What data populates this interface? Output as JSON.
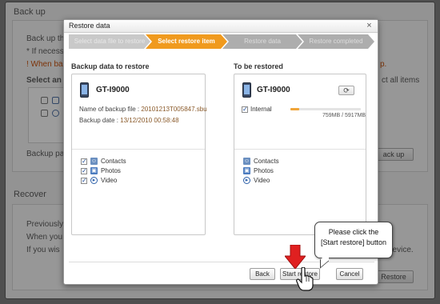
{
  "background": {
    "backup_section": "Back up",
    "backup_line1": "Back up th",
    "backup_line2": "* If necess",
    "backup_warning": "! When ba",
    "backup_warning_tail": "p.",
    "select_label": "Select an",
    "select_all": "ct all items",
    "backup_path_label": "Backup pa",
    "backup_btn": "ack up",
    "recover_section": "Recover",
    "recover_line1": "Previously",
    "recover_line2": "When you",
    "recover_line3": "If you wis",
    "recover_tail": "device.",
    "restore_btn": "Restore"
  },
  "dialog": {
    "title": "Restore data",
    "close": "×",
    "steps": [
      {
        "label": "Select data file to restore",
        "state": "done"
      },
      {
        "label": "Select restore item",
        "state": "active"
      },
      {
        "label": "Restore data",
        "state": "pending"
      },
      {
        "label": "Restore completed",
        "state": "pending"
      }
    ],
    "left": {
      "title": "Backup data to restore",
      "model": "GT-I9000",
      "file_label": "Name of backup file : ",
      "file_value": "20101213T005847.sbu",
      "date_label": "Backup date : ",
      "date_value": "13/12/2010 00:58:48",
      "items": [
        {
          "label": "Contacts",
          "checked": true,
          "icon": "contacts-icon"
        },
        {
          "label": "Photos",
          "checked": true,
          "icon": "photos-icon"
        },
        {
          "label": "Video",
          "checked": true,
          "icon": "video-icon"
        }
      ]
    },
    "right": {
      "title": "To be restored",
      "model": "GT-I9000",
      "refresh_icon": "refresh-icon",
      "storage_label": "Internal",
      "storage_checked": true,
      "storage_text": "759MB / 5917MB",
      "storage_fraction": 0.13,
      "items": [
        {
          "label": "Contacts",
          "icon": "contacts-icon"
        },
        {
          "label": "Photos",
          "icon": "photos-icon"
        },
        {
          "label": "Video",
          "icon": "video-icon"
        }
      ]
    },
    "buttons": {
      "back": "Back",
      "start": "Start restore",
      "cancel": "Cancel"
    }
  },
  "tooltip": {
    "line1": "Please click the",
    "line2": "[Start restore] button"
  },
  "colors": {
    "accent": "#f09a1e",
    "pointer_arrow": "#e02020"
  }
}
